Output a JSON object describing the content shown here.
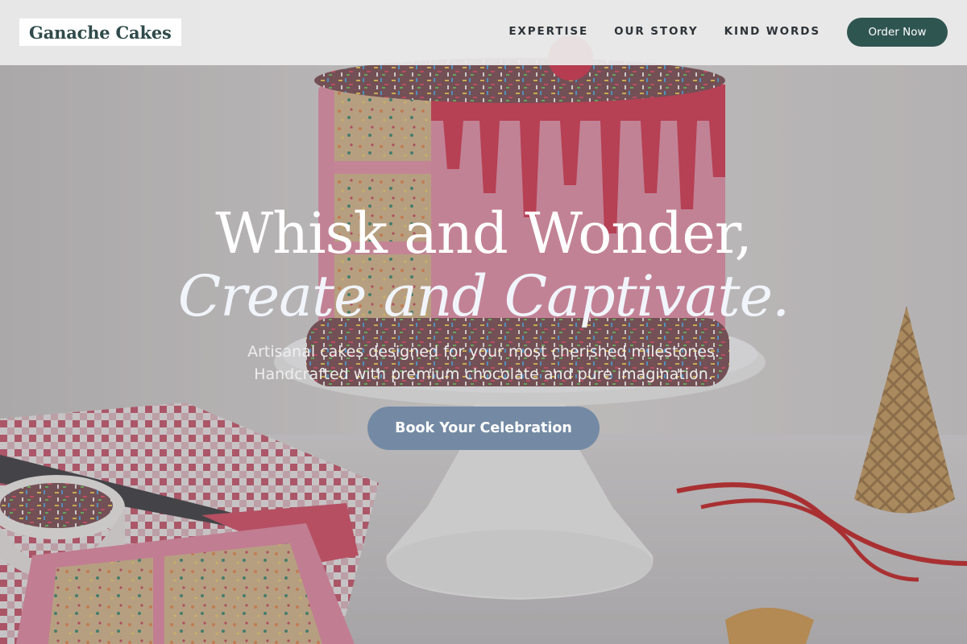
{
  "header": {
    "logo_text": "Ganache Cakes",
    "nav": [
      "EXPERTISE",
      "OUR STORY",
      "KIND WORDS"
    ],
    "order_button": "Order Now"
  },
  "hero": {
    "line1": "Whisk and Wonder,",
    "line2": "Create and Captivate.",
    "subtitle_lines": [
      "Artisanal cakes designed for your most cherished milestones.",
      "Handcrafted with premium chocolate and pure imagination."
    ],
    "cta_label": "Book Your Celebration"
  },
  "colors": {
    "brand_dark_teal": "#2f5551",
    "cta_blue_grey": "#748aa4",
    "header_bg": "#ececec",
    "icing_pink": "#e06d86"
  },
  "background_image": "drip-cake-with-sprinkles-photo"
}
